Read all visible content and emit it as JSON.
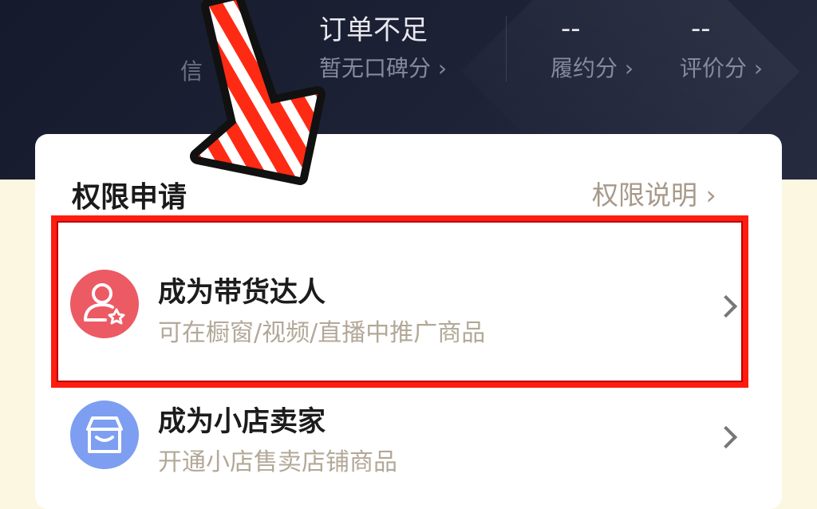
{
  "header": {
    "stats": [
      {
        "value": "订单不足",
        "label": "暂无口碑分 ›"
      },
      {
        "value": "--",
        "label": "履约分 ›"
      },
      {
        "value": "--",
        "label": "评价分 ›"
      }
    ],
    "partial_label": "信"
  },
  "permissions": {
    "title": "权限申请",
    "link": "权限说明 ›",
    "items": [
      {
        "title": "成为带货达人",
        "subtitle": "可在橱窗/视频/直播中推广商品",
        "icon": "user-star-icon",
        "color": "#ec5a64"
      },
      {
        "title": "成为小店卖家",
        "subtitle": "开通小店售卖店铺商品",
        "icon": "shop-icon",
        "color": "#7d9ef1"
      }
    ]
  },
  "annotation": {
    "arrow_colors": [
      "#ff2a14",
      "#ffffff",
      "#111111"
    ],
    "highlight_color": "#ff1c10"
  }
}
